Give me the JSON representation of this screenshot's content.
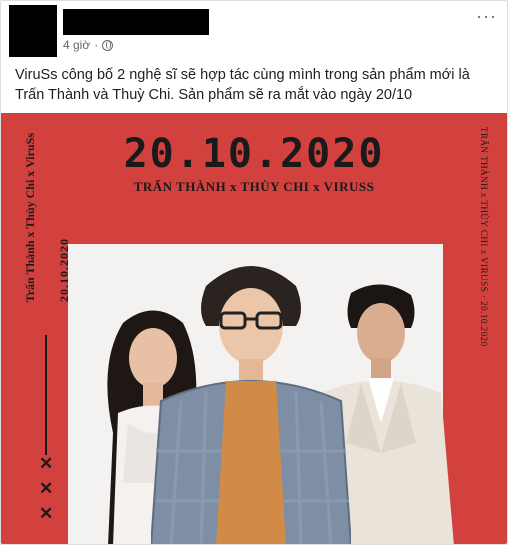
{
  "post": {
    "timestamp": "4 giờ",
    "separator": "·",
    "privacy_icon": "globe-icon",
    "more_icon": "more-horizontal-icon",
    "more_label": "···",
    "caption": "ViruSs công bố 2 nghệ sĩ sẽ hợp tác cùng mình trong sản phẩm mới là Trấn Thành và Thuỳ Chi. Sản phẩm sẽ ra mắt vào ngày 20/10"
  },
  "poster": {
    "date_title": "20.10.2020",
    "artists_line": "TRẤN THÀNH x THÙY CHI x VIRUSS",
    "vertical_left": "Trấn Thành x Thùy Chi x ViruSs",
    "vertical_left_date": "20.10.2020",
    "vertical_right": "TRẤN THÀNH x THÙY CHI x VIRUSS · 20.10.2020",
    "x_marks": "✕\n✕\n✕",
    "colors": {
      "background": "#d3413f",
      "card": "#f3f2f0",
      "ink": "#1a1a1a"
    }
  }
}
